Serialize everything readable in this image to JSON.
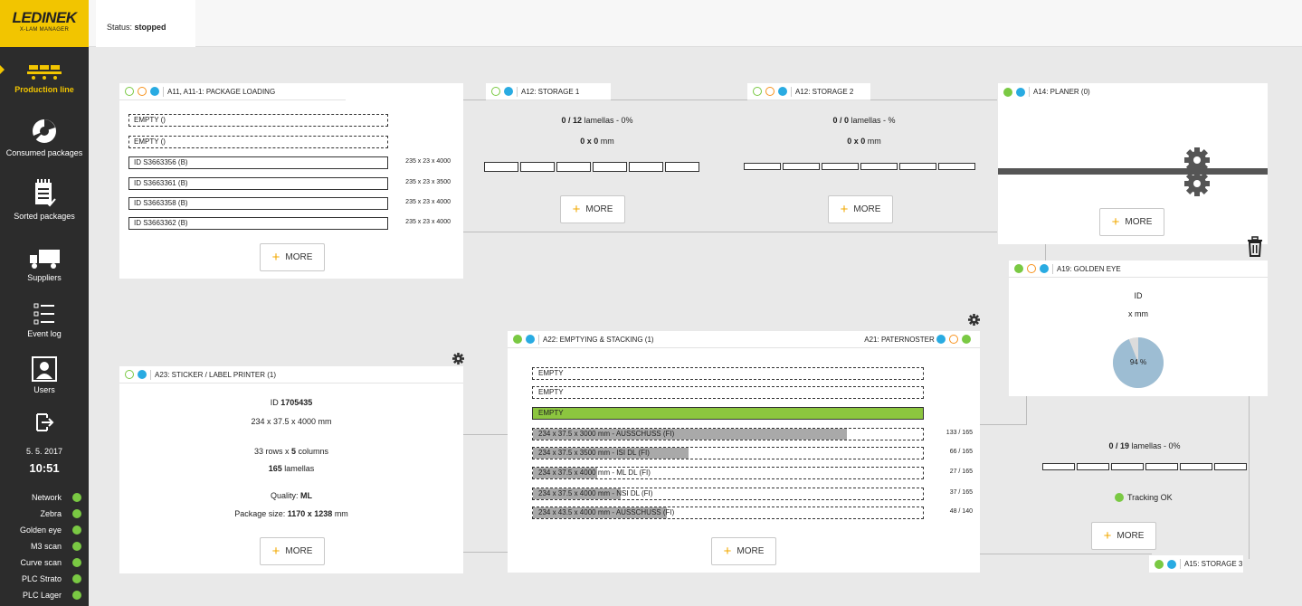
{
  "brand": {
    "name": "LEDINEK",
    "product": "X-LAM MANAGER"
  },
  "sidebar": {
    "items": [
      {
        "label": "Production line",
        "icon": "conveyor-icon"
      },
      {
        "label": "Consumed packages",
        "icon": "pie-icon"
      },
      {
        "label": "Sorted packages",
        "icon": "clipboard-icon"
      },
      {
        "label": "Suppliers",
        "icon": "truck-icon"
      },
      {
        "label": "Event log",
        "icon": "list-icon"
      },
      {
        "label": "Users",
        "icon": "user-icon"
      }
    ],
    "logout_icon": "logout-icon",
    "date": "5. 5. 2017",
    "time": "10:51",
    "statuses": [
      {
        "label": "Network",
        "color": "#7ac943"
      },
      {
        "label": "Zebra",
        "color": "#7ac943"
      },
      {
        "label": "Golden eye",
        "color": "#7ac943"
      },
      {
        "label": "M3 scan",
        "color": "#7ac943"
      },
      {
        "label": "Curve scan",
        "color": "#7ac943"
      },
      {
        "label": "PLC Strato",
        "color": "#7ac943"
      },
      {
        "label": "PLC Lager",
        "color": "#7ac943"
      }
    ]
  },
  "topbar": {
    "status_label": "Status:",
    "status_value": "stopped"
  },
  "more_label": "MORE",
  "a11": {
    "title": "A11, A11-1: PACKAGE LOADING",
    "rows": [
      {
        "label": "EMPTY ()",
        "dim": ""
      },
      {
        "label": "EMPTY ()",
        "dim": ""
      },
      {
        "label": "ID S3663356 (B)",
        "dim": "235 x 23 x 4000"
      },
      {
        "label": "ID S3663361 (B)",
        "dim": "235 x 23 x 3500"
      },
      {
        "label": "ID S3663358 (B)",
        "dim": "235 x 23 x 4000"
      },
      {
        "label": "ID S3663362 (B)",
        "dim": "235 x 23 x 4000"
      }
    ]
  },
  "a12_1": {
    "title": "A12: STORAGE 1",
    "count": "0 / 12",
    "count_suffix": "lamellas - 0%",
    "size": "0 x 0",
    "size_unit": "mm"
  },
  "a12_2": {
    "title": "A12: STORAGE 2",
    "count": "0 / 0",
    "count_suffix": "lamellas - %",
    "size": "0 x 0",
    "size_unit": "mm"
  },
  "a14": {
    "title": "A14: PLANER (0)"
  },
  "a19": {
    "title": "A19: GOLDEN EYE",
    "id_label": "ID",
    "size": "x mm",
    "percent": 94,
    "percent_label": "94 %"
  },
  "a15": {
    "title": "A15: STORAGE 3",
    "count": "0 / 19",
    "count_suffix": "lamellas - 0%",
    "tracking": "Tracking OK"
  },
  "a23": {
    "title": "A23: STICKER / LABEL PRINTER",
    "title_count": "(1)",
    "id_label": "ID",
    "id_value": "1705435",
    "dims": "234 x 37.5 x 4000",
    "dims_unit": "mm",
    "rows_value": "33",
    "rows_text": "rows x",
    "cols_value": "5",
    "cols_text": "columns",
    "lamellas_value": "165",
    "lamellas_text": "lamellas",
    "quality_label": "Quality:",
    "quality_value": "ML",
    "pkg_label": "Package size:",
    "pkg_value": "1170 x 1238",
    "pkg_unit": "mm"
  },
  "a22": {
    "title": "A22: EMPTYING & STACKING",
    "title_count": "(1)",
    "a21_title": "A21: PATERNOSTER",
    "rows": [
      {
        "label": "EMPTY",
        "fill": 0,
        "count": "",
        "active": false
      },
      {
        "label": "EMPTY",
        "fill": 0,
        "count": "",
        "active": false
      },
      {
        "label": "EMPTY",
        "fill": 1,
        "count": "",
        "active": true
      },
      {
        "label": "234 x 37.5 x 3000 mm - AUSSCHUSS (FI)",
        "fill": 0.806,
        "count": "133 / 165",
        "active": false
      },
      {
        "label": "234 x 37.5 x 3500 mm - ISI DL (FI)",
        "fill": 0.4,
        "count": "66 / 165",
        "active": false
      },
      {
        "label": "234 x 37.5 x 4000 mm - ML DL (FI)",
        "fill": 0.164,
        "count": "27 / 165",
        "active": false
      },
      {
        "label": "234 x 37.5 x 4000 mm - NSI DL (FI)",
        "fill": 0.224,
        "count": "37 / 165",
        "active": false
      },
      {
        "label": "234 x 43.5 x 4000 mm - AUSSCHUSS (FI)",
        "fill": 0.343,
        "count": "48 / 140",
        "active": false
      }
    ]
  },
  "colors": {
    "accent": "#f2c500",
    "ok": "#7ac943",
    "info": "#29abe2",
    "active_row": "#8cc63f"
  }
}
